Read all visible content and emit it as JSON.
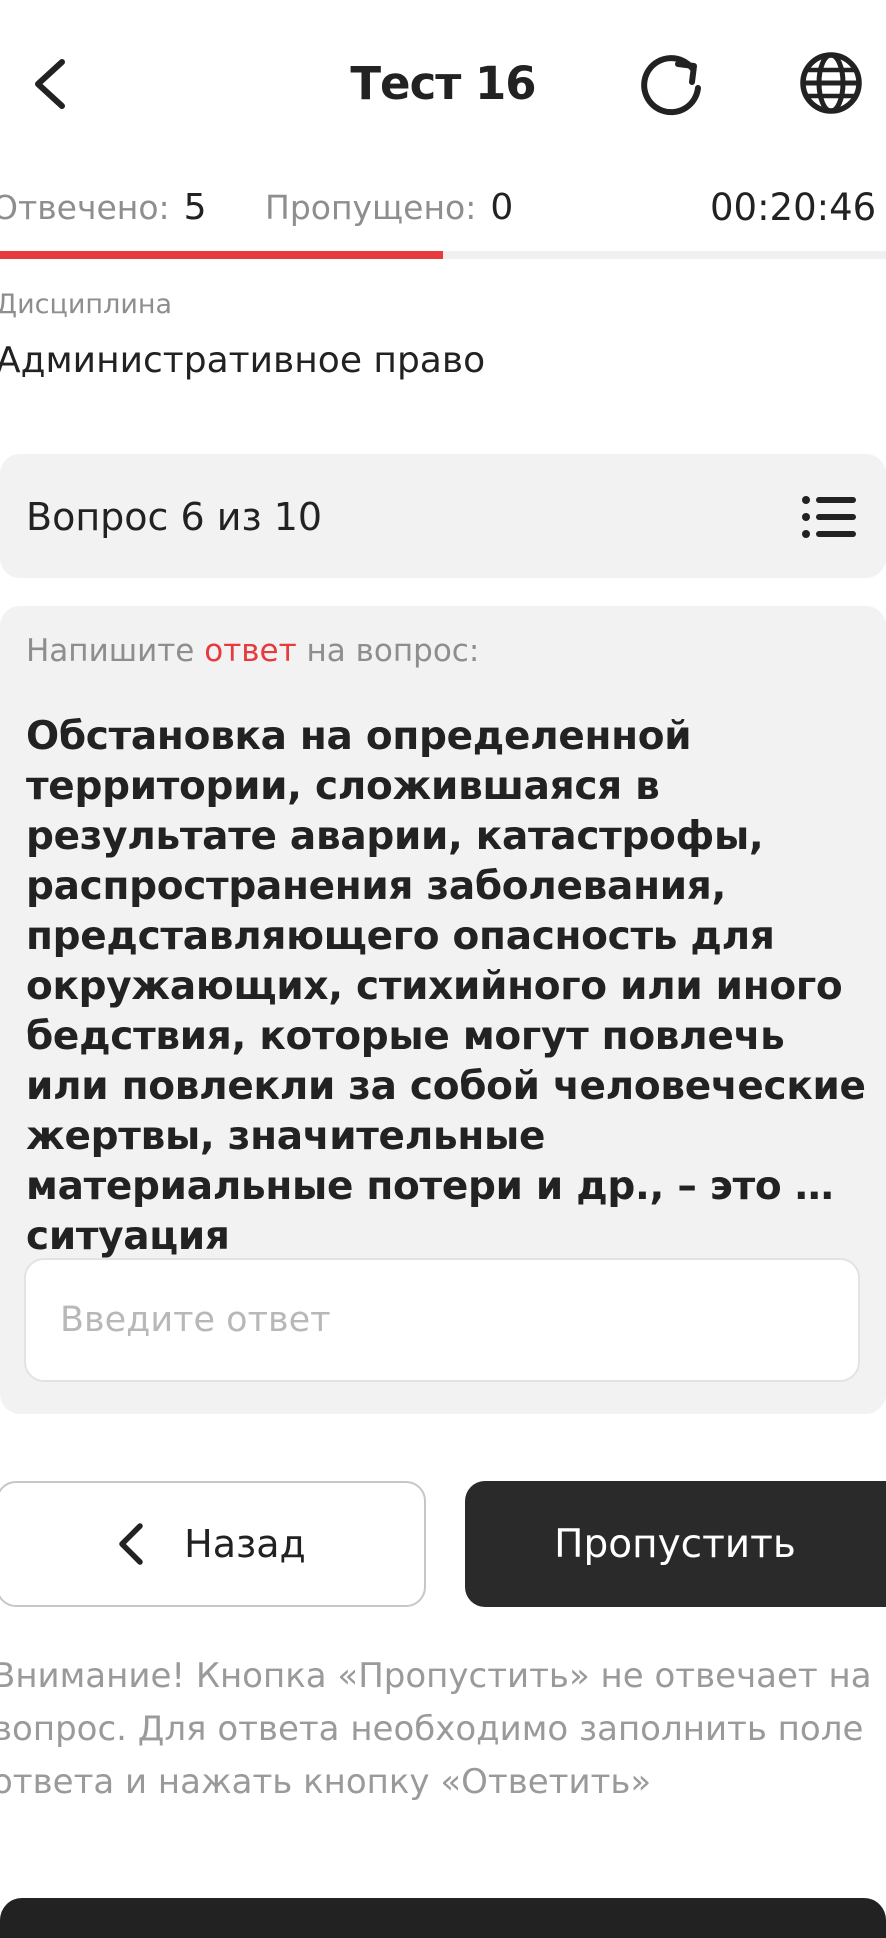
{
  "header": {
    "title": "Тест 16",
    "back_icon": "chevron-left-icon",
    "refresh_icon": "refresh-icon",
    "language_icon": "globe-icon"
  },
  "stats": {
    "answered_label": "Отвечено:",
    "answered_value": "5",
    "skipped_label": "Пропущено:",
    "skipped_value": "0",
    "timer": "00:20:46",
    "progress_fraction": 0.5
  },
  "discipline": {
    "label": "Дисциплина",
    "value": "Административное право"
  },
  "question": {
    "counter": "Вопрос 6 из 10",
    "list_icon": "list-icon",
    "instruction_before": "Напишите",
    "instruction_accent": "ответ",
    "instruction_after": "на вопрос:",
    "text": "Обстановка на определенной территории, сложившаяся в результате аварии, катастрофы, распространения заболевания, представляющего опасность для окружающих, стихийного или иного бедствия, которые могут повлечь или повлекли за собой человеческие жертвы, значительные материальные потери и др., – это … ситуация",
    "answer_value": "",
    "answer_placeholder": "Введите ответ"
  },
  "actions": {
    "back_label": "Назад",
    "skip_label": "Пропустить"
  },
  "warning": "Внимание! Кнопка «Пропустить» не отвечает на вопрос. Для ответа необходимо заполнить поле ответа и нажать кнопку «Ответить»",
  "colors": {
    "accent": "#e8393d",
    "dark": "#2a2a2a",
    "card": "#f2f2f2",
    "muted": "#8e8e8e"
  }
}
